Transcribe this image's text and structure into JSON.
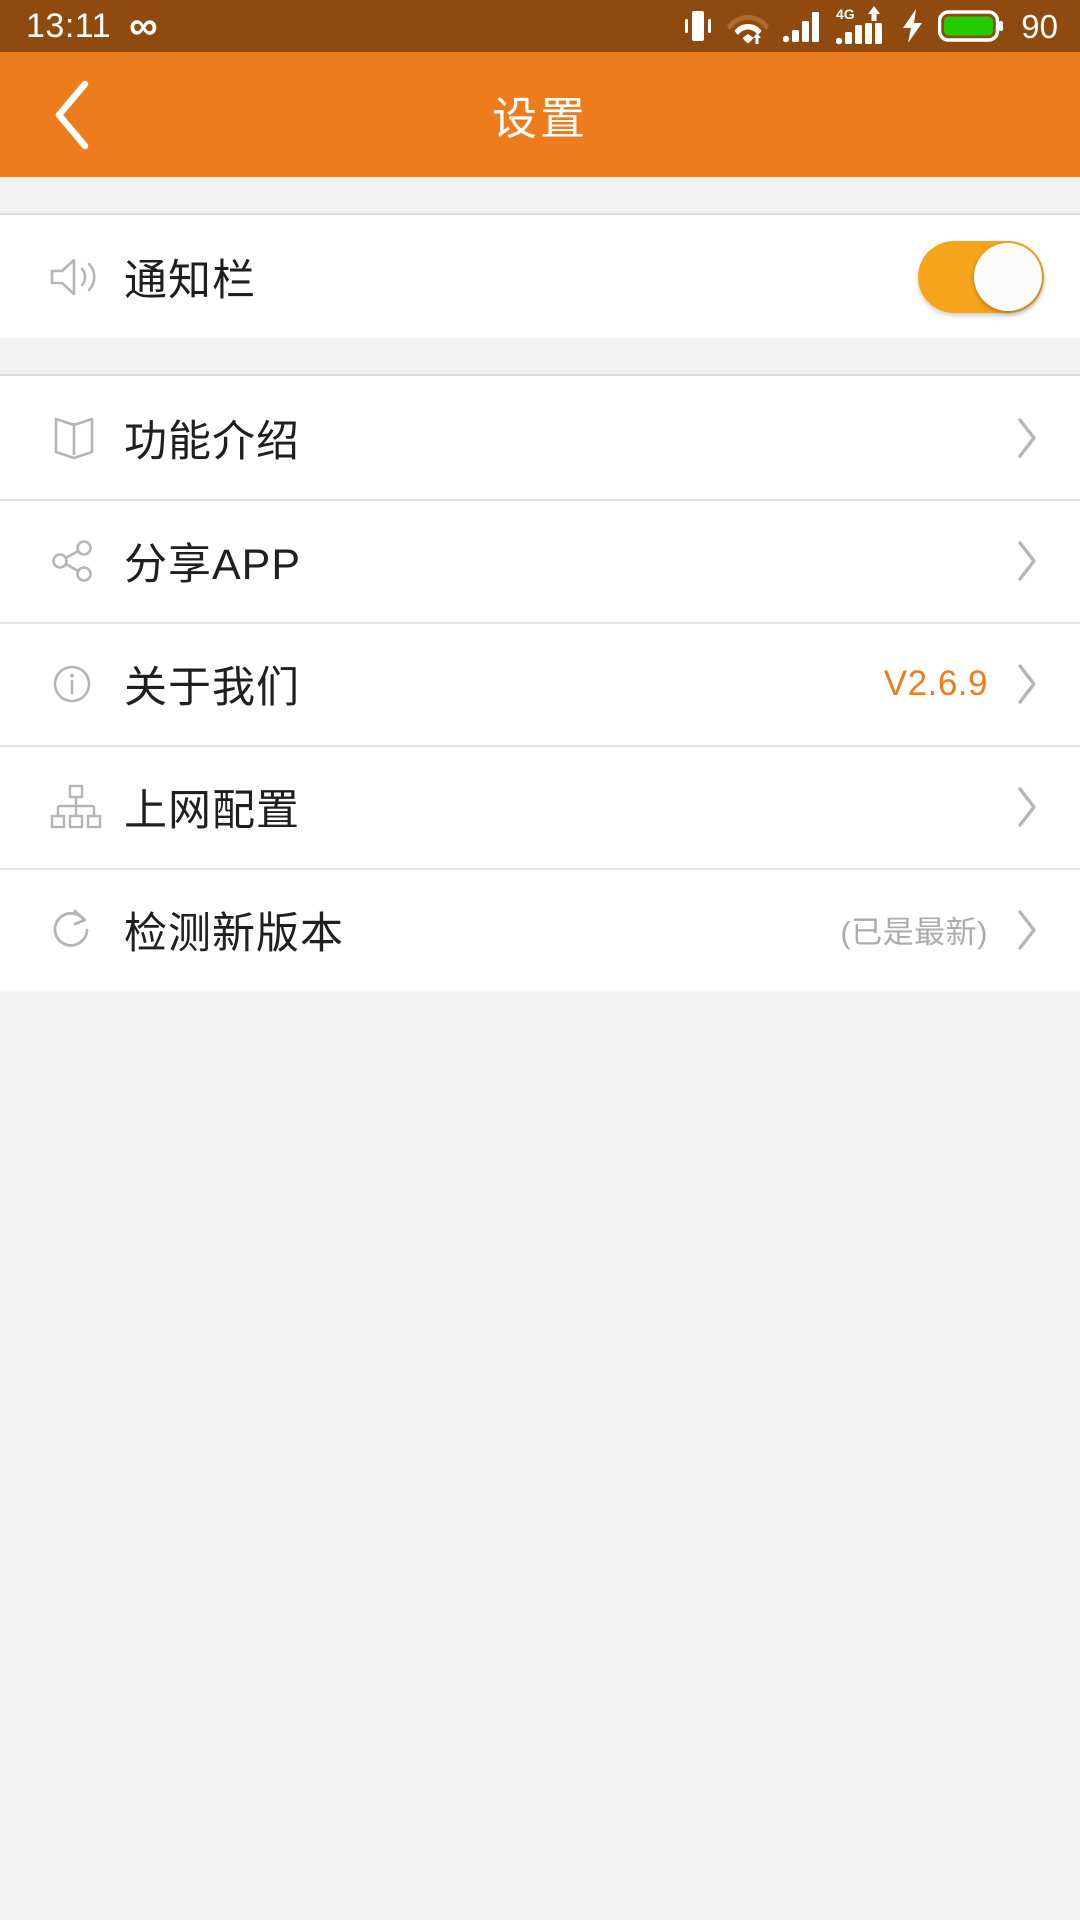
{
  "status_bar": {
    "time": "13:11",
    "infinity_icon": "infinity-icon",
    "vibrate_icon": "vibrate-icon",
    "wifi_icon": "wifi-icon",
    "signal_icon": "signal-bars-icon",
    "network_type": "4G",
    "network_signal_icon": "signal-bars-4g-icon",
    "charging_icon": "charging-bolt-icon",
    "battery_icon": "battery-icon",
    "battery_level": "90",
    "background_color": "#8F4A10",
    "foreground_color": "#FFFFFF",
    "battery_fill_color": "#22CC00"
  },
  "header": {
    "title": "设置",
    "back_icon": "back-chevron-icon",
    "background_color": "#ED7D1C",
    "text_color": "#FFFFFF"
  },
  "settings": {
    "toggle_group": [
      {
        "icon": "speaker-icon",
        "label": "通知栏",
        "toggle_on": true,
        "toggle_color": "#F7A41D"
      }
    ],
    "menu_group": [
      {
        "icon": "book-icon",
        "label": "功能介绍",
        "value": "",
        "value_color": "",
        "chevron": "chevron-right-icon"
      },
      {
        "icon": "share-icon",
        "label": "分享APP",
        "value": "",
        "value_color": "",
        "chevron": "chevron-right-icon"
      },
      {
        "icon": "info-icon",
        "label": "关于我们",
        "value": "V2.6.9",
        "value_color": "#ED7D1C",
        "chevron": "chevron-right-icon"
      },
      {
        "icon": "sitemap-icon",
        "label": "上网配置",
        "value": "",
        "value_color": "",
        "chevron": "chevron-right-icon"
      },
      {
        "icon": "refresh-icon",
        "label": "检测新版本",
        "value": "(已是最新)",
        "value_color": "#ACACAC",
        "chevron": "chevron-right-icon"
      }
    ]
  },
  "colors": {
    "page_background": "#F2F2F2",
    "row_background": "#FFFFFF",
    "divider": "#E3E3E3",
    "icon_gray": "#B5B5B5",
    "label_text": "#1F1F1F"
  }
}
